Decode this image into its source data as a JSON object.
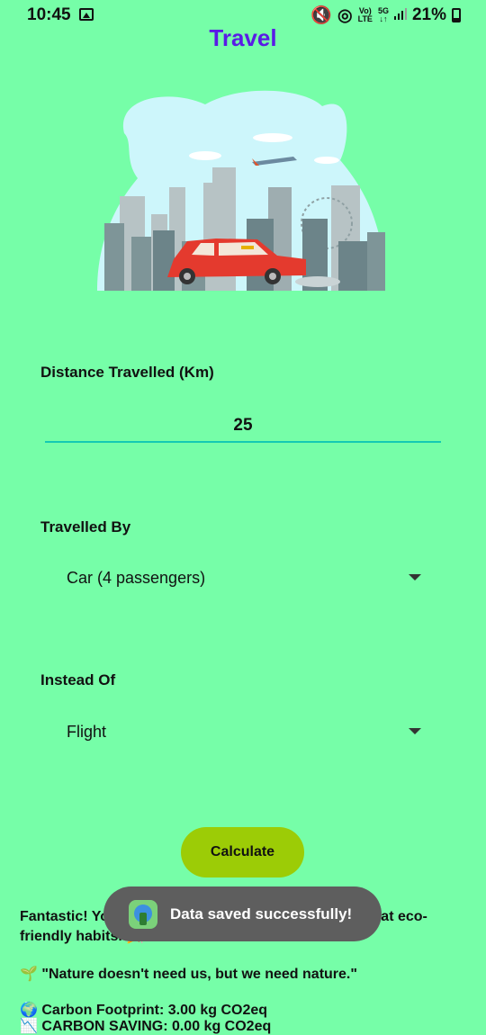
{
  "status_bar": {
    "time": "10:45",
    "network_top": "Vo)",
    "network_bottom": "LTE",
    "fiveg_top": "5G",
    "fiveg_bottom": "↓↑",
    "battery": "21%"
  },
  "page": {
    "title": "Travel"
  },
  "form": {
    "distance_label": "Distance Travelled (Km)",
    "distance_value": "25",
    "travelled_by_label": "Travelled By",
    "travelled_by_value": "Car (4 passengers)",
    "instead_of_label": "Instead Of",
    "instead_of_value": "Flight",
    "calculate_label": "Calculate"
  },
  "result": {
    "line1": "Fantastic! You made a green choice. Keep up the great eco-friendly habits. 🎉",
    "line2": "🌱 \"Nature doesn't need us, but we need nature.\"",
    "line3": "🌍 Carbon Footprint: 3.00 kg CO2eq",
    "line4": "📉 CARBON SAVING: 0.00 kg CO2eq"
  },
  "toast": {
    "message": "Data saved successfully!"
  },
  "colors": {
    "background": "#76FEA8",
    "title": "#5A1BE6",
    "input_line": "#14C9B3",
    "button": "#9CCC06",
    "toast": "#5E5E5E"
  }
}
